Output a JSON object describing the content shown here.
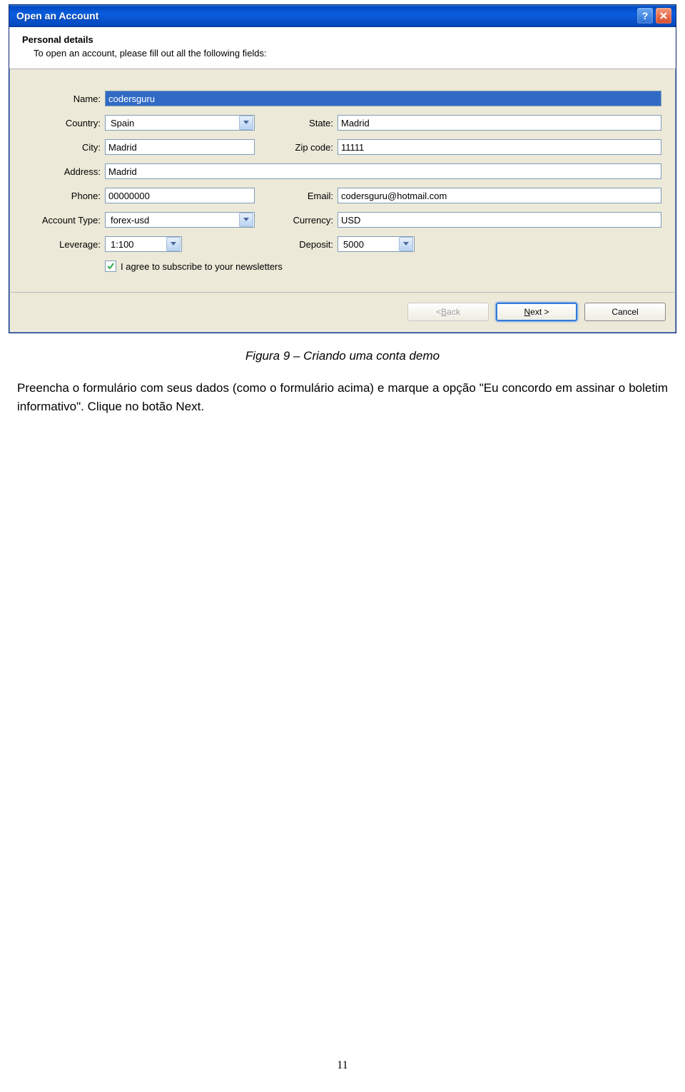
{
  "window": {
    "title": "Open an Account",
    "header_title": "Personal details",
    "header_sub": "To open an account, please fill out all the following fields:"
  },
  "labels": {
    "name": "Name:",
    "country": "Country:",
    "state": "State:",
    "city": "City:",
    "zip": "Zip code:",
    "address": "Address:",
    "phone": "Phone:",
    "email": "Email:",
    "account_type": "Account Type:",
    "currency": "Currency:",
    "leverage": "Leverage:",
    "deposit": "Deposit:"
  },
  "values": {
    "name": "codersguru",
    "country": "Spain",
    "state": "Madrid",
    "city": "Madrid",
    "zip": "11111",
    "address": "Madrid",
    "phone": "00000000",
    "email": "codersguru@hotmail.com",
    "account_type": "forex-usd",
    "currency": "USD",
    "leverage": "1:100",
    "deposit": "5000"
  },
  "checkbox": {
    "label": "I agree to subscribe to your newsletters",
    "checked": true
  },
  "buttons": {
    "back_prefix": "< ",
    "back_u": "B",
    "back_suffix": "ack",
    "next_u": "N",
    "next_suffix": "ext >",
    "cancel": "Cancel"
  },
  "caption": "Figura 9 – Criando uma conta demo",
  "paragraph": "Preencha o formulário com seus dados (como o formulário acima) e marque a opção \"Eu concordo em assinar o boletim informativo\". Clique no botão Next.",
  "page_number": "11"
}
